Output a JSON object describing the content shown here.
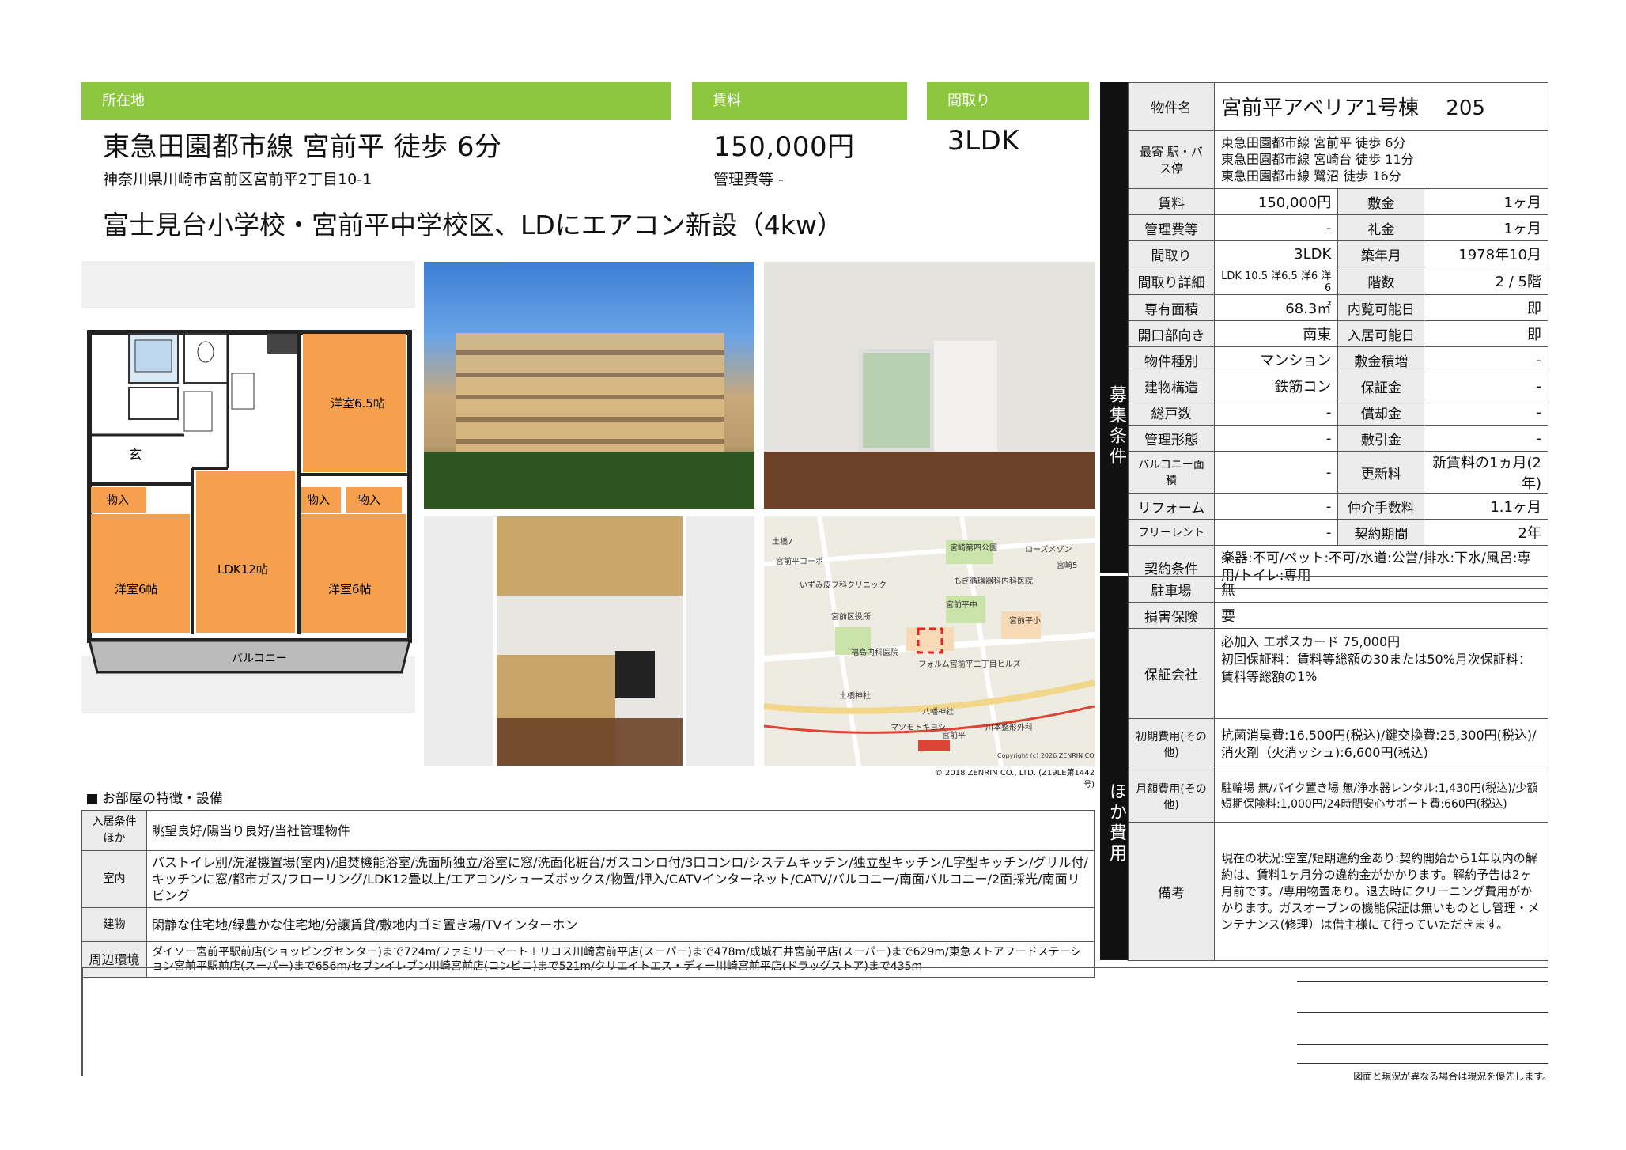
{
  "top": {
    "location_label": "所在地",
    "rent_label": "賃料",
    "layout_label": "間取り",
    "access": "東急田園都市線 宮前平 徒歩 6分",
    "address": "神奈川県川崎市宮前区宮前平2丁目10-1",
    "rent": "150,000円",
    "mgmt_fee": "管理費等 -",
    "layout": "3LDK",
    "catch_copy": "富士見台小学校・宮前平中学校区、LDにエアコン新設（4kw）"
  },
  "floorplan": {
    "rooms": [
      "洋室6.5帖",
      "物入",
      "物入",
      "物入",
      "洋室6帖",
      "LDK12帖",
      "洋室6帖",
      "バルコニー",
      "玄"
    ]
  },
  "map": {
    "labels": [
      "宮崎第四公園",
      "ローズメゾン",
      "宮崎5",
      "土橋7",
      "宮前平コーポ",
      "いずみ皮フ科クリニック",
      "もぎ循環器科内科医院",
      "宮前平中",
      "宮前区役所",
      "宮前平小",
      "福島内科医院",
      "フォルム宮前平二丁目ヒルズ",
      "土橋神社",
      "八幡神社",
      "川本整形外科",
      "マツモトキヨシ",
      "宮前平"
    ],
    "copyright_inner": "Copyright (c) 2026 ZENRIN CO.,LTD.",
    "copyright": "© 2018 ZENRIN CO., LTD. (Z19LE第1442号)"
  },
  "features": {
    "heading": "お部屋の特徴・設備",
    "rows": [
      {
        "label": "入居条件ほか",
        "value": "眺望良好/陽当り良好/当社管理物件"
      },
      {
        "label": "室内",
        "value": "バストイレ別/洗濯機置場(室内)/追焚機能浴室/洗面所独立/浴室に窓/洗面化粧台/ガスコンロ付/3口コンロ/システムキッチン/独立型キッチン/L字型キッチン/グリル付/キッチンに窓/都市ガス/フローリング/LDK12畳以上/エアコン/シューズボックス/物置/押入/CATVインターネット/CATV/バルコニー/南面バルコニー/2面採光/南面リビング"
      },
      {
        "label": "建物",
        "value": "閑静な住宅地/緑豊かな住宅地/分譲賃貸/敷地内ゴミ置き場/TVインターホン"
      },
      {
        "label": "周辺環境",
        "value": "ダイソー宮前平駅前店(ショッピングセンター)まで724m/ファミリーマート＋リコス川崎宮前平店(スーパー)まで478m/成城石井宮前平店(スーパー)まで629m/東急ストアフードステーション宮前平駅前店(スーパー)まで656m/セブンイレブン川崎宮前店(コンビニ)まで521m/クリエイトエス・ディー川崎宮前平店(ドラッグストア)まで435m"
      }
    ]
  },
  "conditions": {
    "side_label": "募集条件",
    "property_name_label": "物件名",
    "property_name": "宮前平アベリア1号棟　 205",
    "station_label": "最寄 駅・バス停",
    "stations": [
      "東急田園都市線 宮前平 徒歩 6分",
      "東急田園都市線 宮崎台 徒歩 11分",
      "東急田園都市線 鷺沼 徒歩 16分"
    ],
    "rows": [
      [
        "賃料",
        "150,000円",
        "敷金",
        "1ヶ月"
      ],
      [
        "管理費等",
        "-",
        "礼金",
        "1ヶ月"
      ],
      [
        "間取り",
        "3LDK",
        "築年月",
        "1978年10月"
      ],
      [
        "間取り詳細",
        "LDK 10.5 洋6.5 洋6 洋6",
        "階数",
        "2 / 5階"
      ],
      [
        "専有面積",
        "68.3㎡",
        "内覧可能日",
        "即"
      ],
      [
        "開口部向き",
        "南東",
        "入居可能日",
        "即"
      ],
      [
        "物件種別",
        "マンション",
        "敷金積増",
        "-"
      ],
      [
        "建物構造",
        "鉄筋コン",
        "保証金",
        "-"
      ],
      [
        "総戸数",
        "-",
        "償却金",
        "-"
      ],
      [
        "管理形態",
        "-",
        "敷引金",
        "-"
      ],
      [
        "バルコニー面積",
        "-",
        "更新料",
        "新賃料の1ヵ月(2年)"
      ],
      [
        "リフォーム",
        "-",
        "仲介手数料",
        "1.1ヶ月"
      ],
      [
        "フリーレント",
        "-",
        "契約期間",
        "2年"
      ]
    ],
    "contract_label": "契約条件",
    "contract": "楽器:不可/ペット:不可/水道:公営/排水:下水/風呂:専用/トイレ:専用"
  },
  "other": {
    "side_label": "ほか費用",
    "rows": [
      {
        "label": "駐車場",
        "value": "無"
      },
      {
        "label": "損害保険",
        "value": "要"
      },
      {
        "label": "保証会社",
        "value": "必加入 エポスカード 75,000円\n初回保証料：賃料等総額の30または50%月次保証料：賃料等総額の1%"
      },
      {
        "label": "初期費用(その他)",
        "value": "抗菌消臭費:16,500円(税込)/鍵交換費:25,300円(税込)/消火剤（火消ッシュ):6,600円(税込)"
      },
      {
        "label": "月額費用(その他)",
        "value": "駐輪場 無/バイク置き場 無/浄水器レンタル:1,430円(税込)/少額短期保険料:1,000円/24時間安心サポート費:660円(税込)"
      },
      {
        "label": "備考",
        "value": "現在の状況:空室/短期違約金あり:契約開始から1年以内の解約は、賃料1ヶ月分の違約金がかかります。解約予告は2ヶ月前です。/専用物置あり。退去時にクリーニング費用がかかります。ガスオーブンの機能保証は無いものとし管理・メンテナンス(修理）は借主様にて行っていただきます。"
      }
    ]
  },
  "footer": {
    "note": "図面と現況が異なる場合は現況を優先します。"
  }
}
